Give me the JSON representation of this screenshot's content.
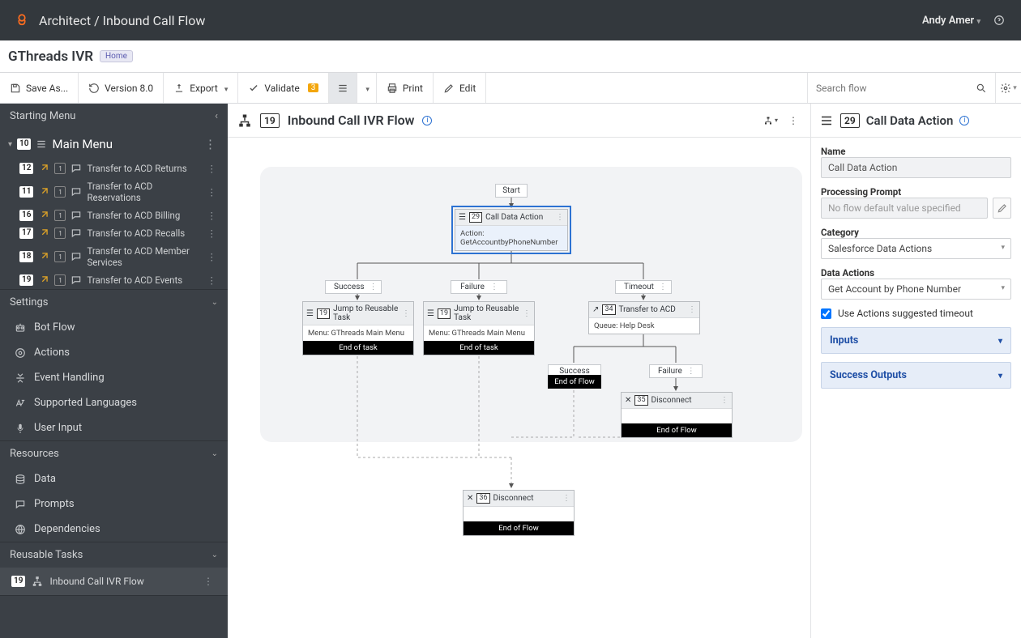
{
  "topbar": {
    "breadcrumb": "Architect / Inbound Call Flow",
    "user": "Andy Amer"
  },
  "subheader": {
    "flowname": "GThreads IVR",
    "home_pill": "Home"
  },
  "toolbar": {
    "save_as": "Save As...",
    "version": "Version 8.0",
    "export": "Export",
    "validate": "Validate",
    "validate_count": "3",
    "print": "Print",
    "edit": "Edit",
    "search_placeholder": "Search flow"
  },
  "sidebar": {
    "starting_menu": "Starting Menu",
    "main_menu": {
      "num": "10",
      "label": "Main Menu"
    },
    "menu_items": [
      {
        "num": "12",
        "label": "Transfer to ACD Returns"
      },
      {
        "num": "11",
        "label": "Transfer to ACD Reservations"
      },
      {
        "num": "16",
        "label": "Transfer to ACD Billing"
      },
      {
        "num": "17",
        "label": "Transfer to ACD Recalls"
      },
      {
        "num": "18",
        "label": "Transfer to ACD Member Services"
      },
      {
        "num": "19",
        "label": "Transfer to ACD Events"
      }
    ],
    "settings_header": "Settings",
    "settings": [
      {
        "icon": "bot",
        "label": "Bot Flow"
      },
      {
        "icon": "actions",
        "label": "Actions"
      },
      {
        "icon": "event",
        "label": "Event Handling"
      },
      {
        "icon": "lang",
        "label": "Supported Languages"
      },
      {
        "icon": "mic",
        "label": "User Input"
      }
    ],
    "resources_header": "Resources",
    "resources": [
      {
        "icon": "data",
        "label": "Data"
      },
      {
        "icon": "prompts",
        "label": "Prompts"
      },
      {
        "icon": "deps",
        "label": "Dependencies"
      }
    ],
    "reusable_header": "Reusable Tasks",
    "reusable": {
      "num": "19",
      "label": "Inbound Call IVR Flow"
    }
  },
  "canvas_head": {
    "num": "19",
    "title": "Inbound Call IVR Flow"
  },
  "flow": {
    "start": "Start",
    "call_data": {
      "num": "29",
      "title": "Call Data Action",
      "body": "Action: GetAccountbyPhoneNumber"
    },
    "branches": {
      "success": "Success",
      "failure": "Failure",
      "timeout": "Timeout"
    },
    "jump1": {
      "num": "19",
      "title": "Jump to Reusable Task",
      "body": "Menu: GThreads Main Menu",
      "foot": "End of task"
    },
    "jump2": {
      "num": "19",
      "title": "Jump to Reusable Task",
      "body": "Menu: GThreads Main Menu",
      "foot": "End of task"
    },
    "transfer": {
      "num": "34",
      "title": "Transfer to ACD",
      "body": "Queue: Help Desk"
    },
    "branches2": {
      "success": "Success",
      "failure": "Failure"
    },
    "success_foot": "End of Flow",
    "disconnect1": {
      "num": "35",
      "title": "Disconnect",
      "foot": "End of Flow"
    },
    "disconnect2": {
      "num": "36",
      "title": "Disconnect",
      "foot": "End of Flow"
    }
  },
  "right": {
    "head_num": "29",
    "head_title": "Call Data Action",
    "name_label": "Name",
    "name_value": "Call Data Action",
    "prompt_label": "Processing Prompt",
    "prompt_value": "No flow default value specified",
    "category_label": "Category",
    "category_value": "Salesforce Data Actions",
    "dataactions_label": "Data Actions",
    "dataactions_value": "Get Account by Phone Number",
    "timeout_check": "Use Actions suggested timeout",
    "inputs": "Inputs",
    "success_outputs": "Success Outputs"
  }
}
